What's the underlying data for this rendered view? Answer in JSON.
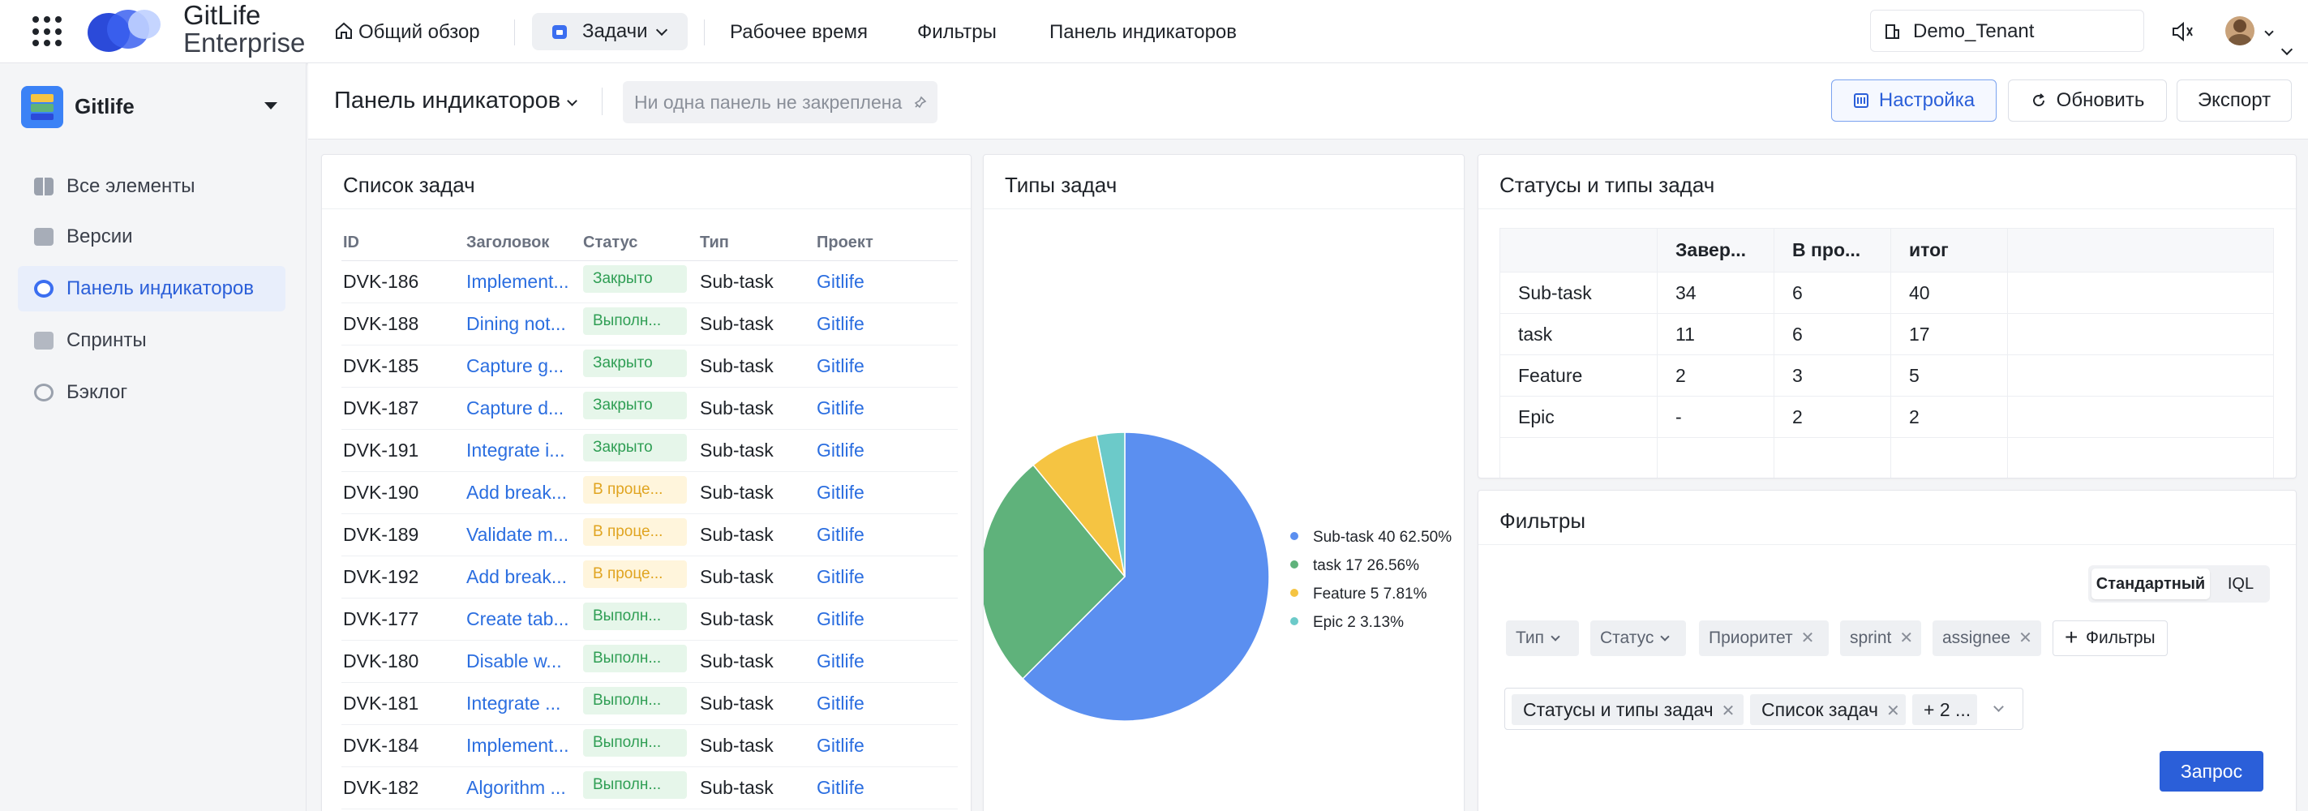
{
  "topbar": {
    "logo_line1": "GitLife",
    "logo_line2": "Enterprise",
    "nav": {
      "overview": "Общий обзор",
      "tasks": "Задачи",
      "work_time": "Рабочее время",
      "filters": "Фильтры",
      "dashboard": "Панель индикаторов"
    },
    "tenant": "Demo_Tenant",
    "icons": [
      "apps-grid-icon",
      "home-icon",
      "task-icon",
      "building-icon",
      "speaker-icon",
      "avatar"
    ]
  },
  "sidebar": {
    "space_name": "Gitlife",
    "items": [
      {
        "label": "Все элементы",
        "icon": "grid-icon"
      },
      {
        "label": "Версии",
        "icon": "version-icon"
      },
      {
        "label": "Панель индикаторов",
        "icon": "dashboard-icon"
      },
      {
        "label": "Спринты",
        "icon": "sprint-icon"
      },
      {
        "label": "Бэклог",
        "icon": "backlog-icon"
      }
    ]
  },
  "toolbar": {
    "title": "Панель индикаторов",
    "pinned_placeholder": "Ни одна панель не закреплена",
    "settings": "Настройка",
    "refresh": "Обновить",
    "export": "Экспорт"
  },
  "task_list": {
    "title": "Список задач",
    "columns": [
      "ID",
      "Заголовок",
      "Статус",
      "Тип",
      "Проект"
    ],
    "rows": [
      {
        "id": "DVK-186",
        "title": "Implement...",
        "status": "Закрыто",
        "status_color": "green",
        "type": "Sub-task",
        "project": "Gitlife"
      },
      {
        "id": "DVK-188",
        "title": "Dining not...",
        "status": "Выполн...",
        "status_color": "green",
        "type": "Sub-task",
        "project": "Gitlife"
      },
      {
        "id": "DVK-185",
        "title": "Capture g...",
        "status": "Закрыто",
        "status_color": "green",
        "type": "Sub-task",
        "project": "Gitlife"
      },
      {
        "id": "DVK-187",
        "title": "Capture d...",
        "status": "Закрыто",
        "status_color": "green",
        "type": "Sub-task",
        "project": "Gitlife"
      },
      {
        "id": "DVK-191",
        "title": "Integrate i...",
        "status": "Закрыто",
        "status_color": "green",
        "type": "Sub-task",
        "project": "Gitlife"
      },
      {
        "id": "DVK-190",
        "title": "Add break...",
        "status": "В проце...",
        "status_color": "yellow",
        "type": "Sub-task",
        "project": "Gitlife"
      },
      {
        "id": "DVK-189",
        "title": "Validate m...",
        "status": "В проце...",
        "status_color": "yellow",
        "type": "Sub-task",
        "project": "Gitlife"
      },
      {
        "id": "DVK-192",
        "title": "Add break...",
        "status": "В проце...",
        "status_color": "yellow",
        "type": "Sub-task",
        "project": "Gitlife"
      },
      {
        "id": "DVK-177",
        "title": "Create tab...",
        "status": "Выполн...",
        "status_color": "green",
        "type": "Sub-task",
        "project": "Gitlife"
      },
      {
        "id": "DVK-180",
        "title": "Disable w...",
        "status": "Выполн...",
        "status_color": "green",
        "type": "Sub-task",
        "project": "Gitlife"
      },
      {
        "id": "DVK-181",
        "title": "Integrate ...",
        "status": "Выполн...",
        "status_color": "green",
        "type": "Sub-task",
        "project": "Gitlife"
      },
      {
        "id": "DVK-184",
        "title": "Implement...",
        "status": "Выполн...",
        "status_color": "green",
        "type": "Sub-task",
        "project": "Gitlife"
      },
      {
        "id": "DVK-182",
        "title": "Algorithm ...",
        "status": "Выполн...",
        "status_color": "green",
        "type": "Sub-task",
        "project": "Gitlife"
      }
    ]
  },
  "task_types": {
    "title": "Типы задач"
  },
  "chart_data": {
    "type": "pie",
    "title": "Типы задач",
    "slices": [
      {
        "name": "Sub-task",
        "value": 40,
        "percent": "62.50%",
        "color": "#5b8ff0",
        "legend": "Sub-task 40 62.50%"
      },
      {
        "name": "task",
        "value": 17,
        "percent": "26.56%",
        "color": "#5fb27b",
        "legend": "task 17 26.56%"
      },
      {
        "name": "Feature",
        "value": 5,
        "percent": "7.81%",
        "color": "#f5c442",
        "legend": "Feature 5 7.81%"
      },
      {
        "name": "Epic",
        "value": 2,
        "percent": "3.13%",
        "color": "#6ccac9",
        "legend": "Epic 2 3.13%"
      }
    ],
    "legend_position": "right"
  },
  "status_types": {
    "title": "Статусы и типы задач",
    "columns": [
      "",
      "Завер...",
      "В про...",
      "итог",
      ""
    ],
    "rows": [
      [
        "Sub-task",
        "34",
        "6",
        "40"
      ],
      [
        "task",
        "11",
        "6",
        "17"
      ],
      [
        "Feature",
        "2",
        "3",
        "5"
      ],
      [
        "Epic",
        "-",
        "2",
        "2"
      ]
    ]
  },
  "filters": {
    "title": "Фильтры",
    "mode_standard": "Стандартный",
    "mode_iql": "IQL",
    "chips": [
      "Тип",
      "Статус",
      "Приоритет",
      "sprint",
      "assignee"
    ],
    "add_filter": "Фильтры",
    "selected": [
      "Статусы и типы задач",
      "Список задач",
      "+ 2 ..."
    ],
    "query": "Запрос"
  }
}
